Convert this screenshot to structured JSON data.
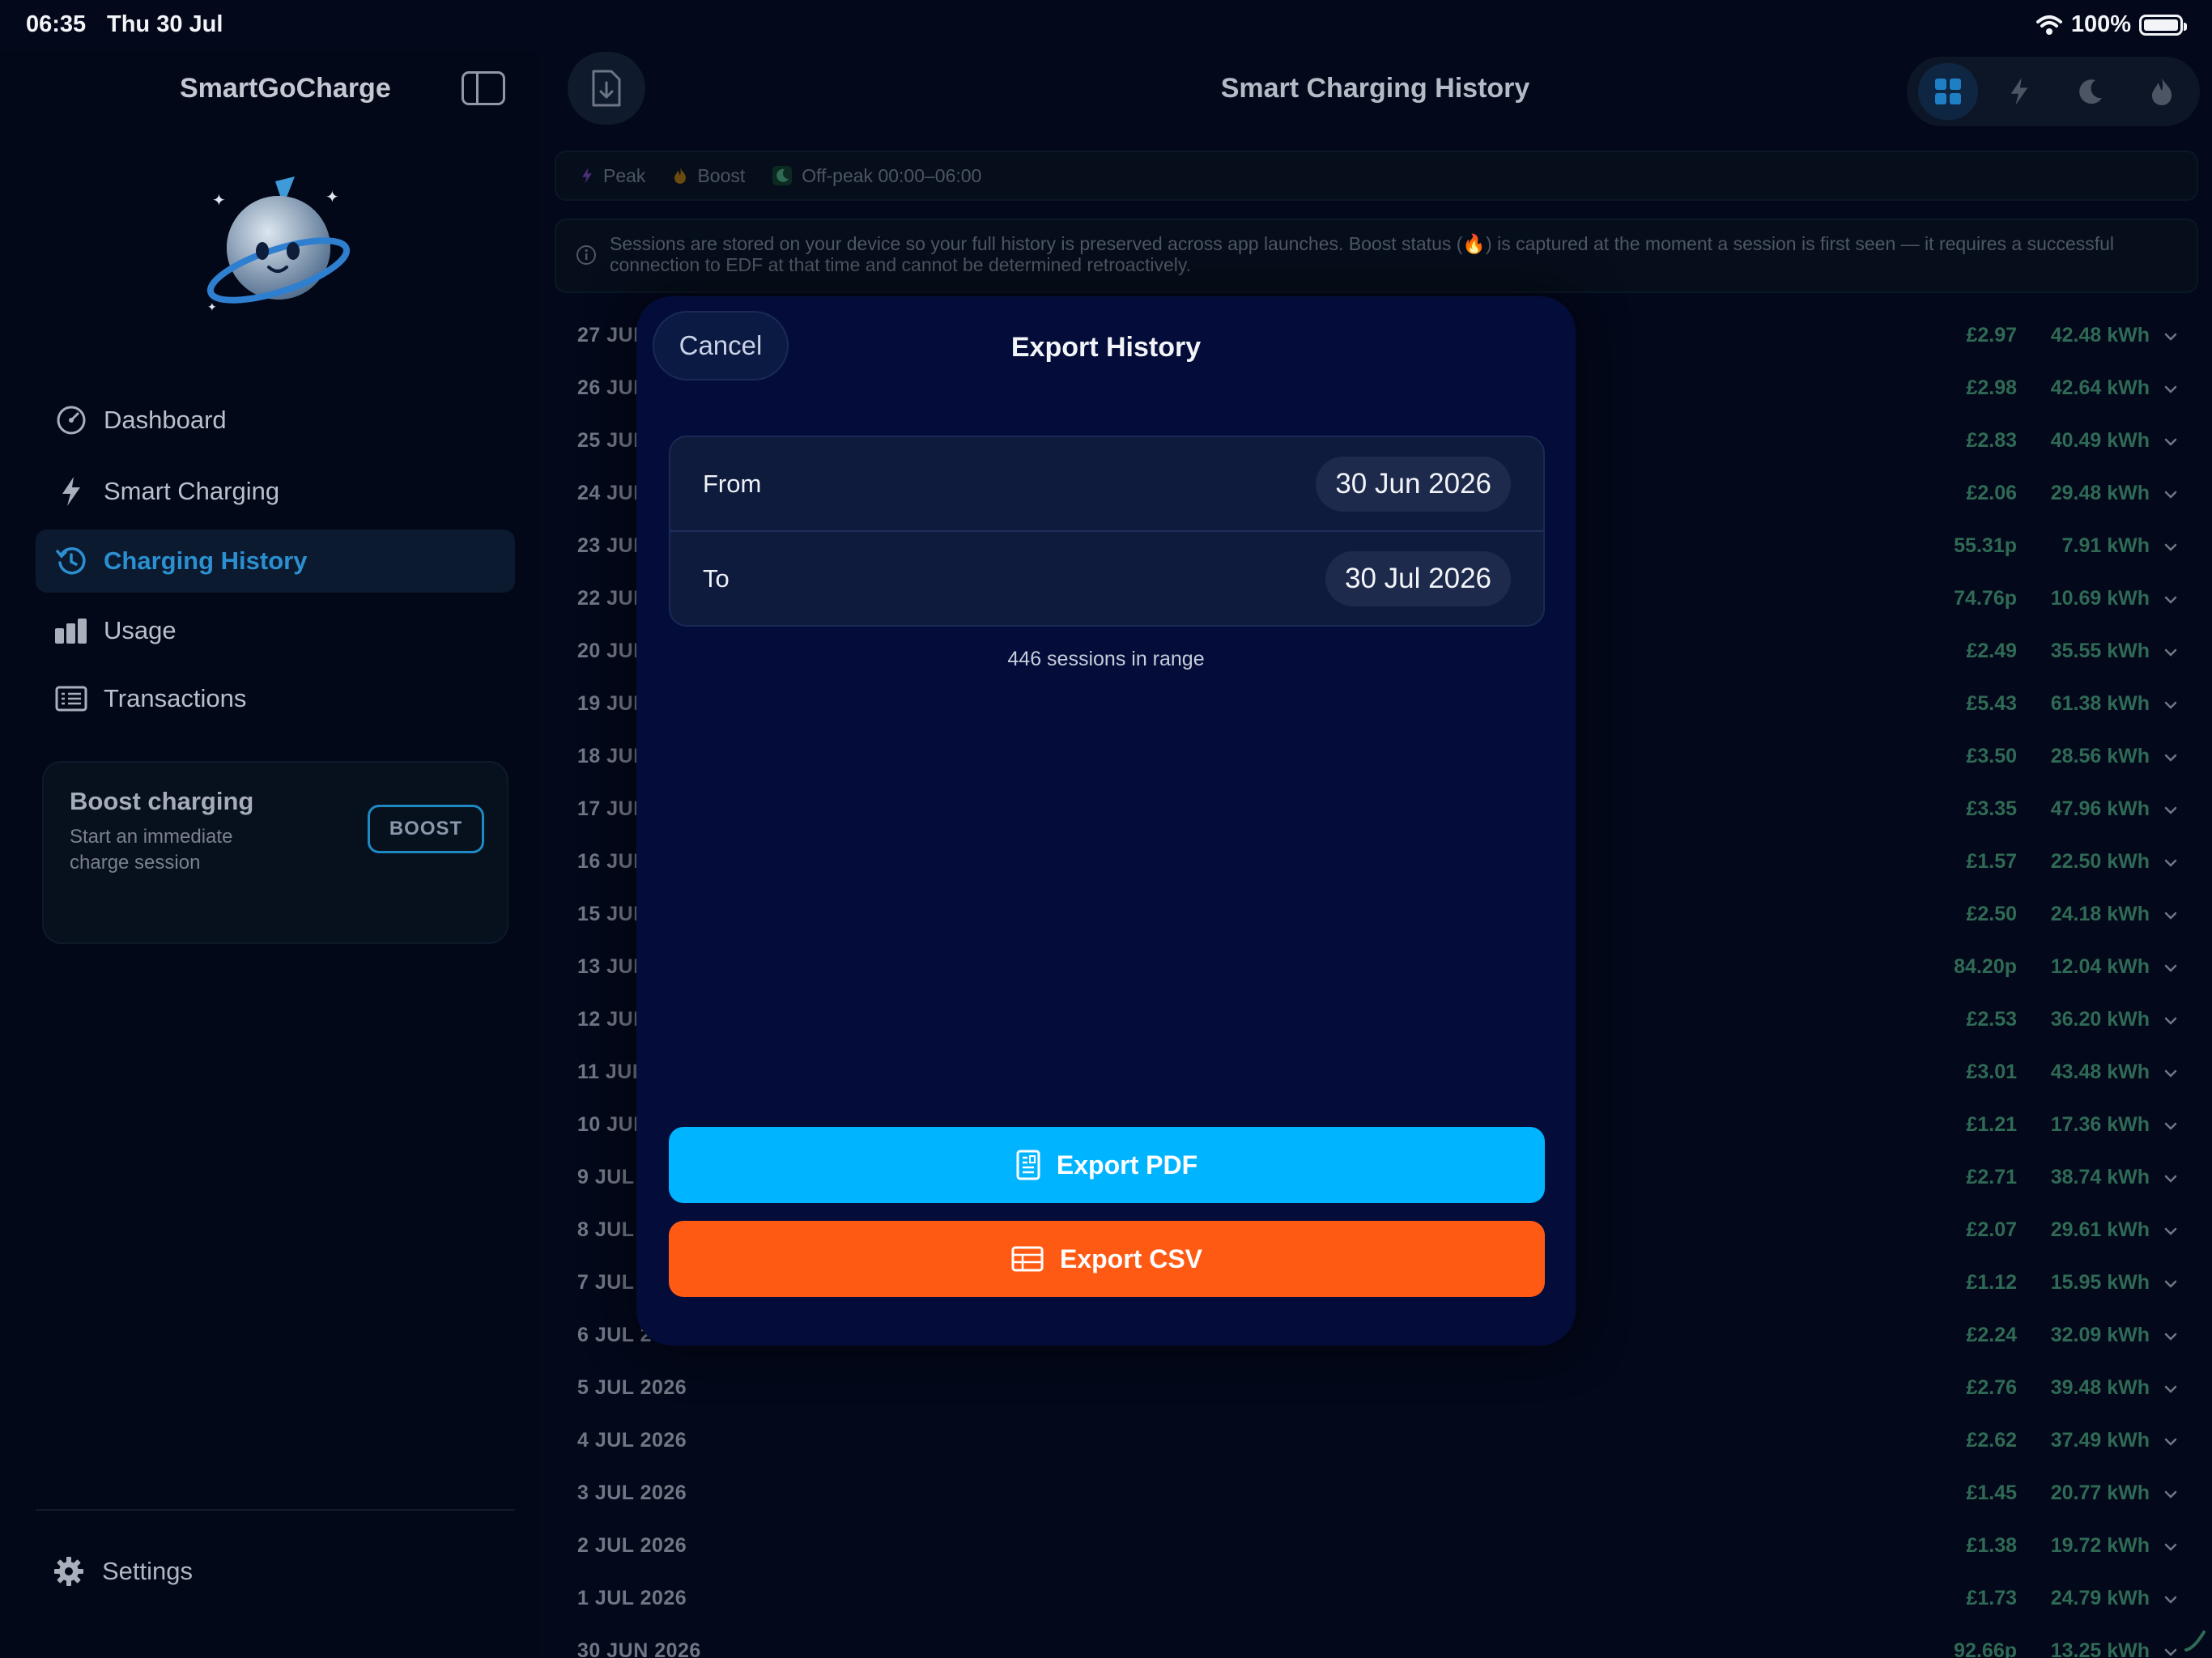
{
  "status_bar": {
    "time": "06:35",
    "date": "Thu 30 Jul",
    "battery": "100%"
  },
  "sidebar": {
    "app_title": "SmartGoCharge",
    "nav": [
      {
        "label": "Dashboard",
        "icon": "speedometer-icon",
        "active": false
      },
      {
        "label": "Smart Charging",
        "icon": "bolt-icon",
        "active": false
      },
      {
        "label": "Charging History",
        "icon": "history-icon",
        "active": true
      },
      {
        "label": "Usage",
        "icon": "bar-chart-icon",
        "active": false
      },
      {
        "label": "Transactions",
        "icon": "list-icon",
        "active": false
      }
    ],
    "boost": {
      "title": "Boost charging",
      "description": "Start an immediate charge session",
      "button": "BOOST"
    },
    "settings_label": "Settings"
  },
  "header": {
    "title": "Smart Charging History"
  },
  "legend": {
    "peak": "Peak",
    "boost": "Boost",
    "offpeak": "Off-peak 00:00–06:00"
  },
  "info_text": "Sessions are stored on your device so your full history is preserved across app launches. Boost status (🔥) is captured at the moment a session is first seen — it requires a successful connection to EDF at that time and cannot be determined retroactively.",
  "history": [
    {
      "date": "27 JUL",
      "cost": "£2.97",
      "kwh": "42.48 kWh"
    },
    {
      "date": "26 JUL",
      "cost": "£2.98",
      "kwh": "42.64 kWh"
    },
    {
      "date": "25 JUL",
      "cost": "£2.83",
      "kwh": "40.49 kWh"
    },
    {
      "date": "24 JUL",
      "cost": "£2.06",
      "kwh": "29.48 kWh"
    },
    {
      "date": "23 JUL",
      "cost": "55.31p",
      "kwh": "7.91 kWh"
    },
    {
      "date": "22 JUL",
      "cost": "74.76p",
      "kwh": "10.69 kWh"
    },
    {
      "date": "20 JUL",
      "cost": "£2.49",
      "kwh": "35.55 kWh"
    },
    {
      "date": "19 JUL",
      "cost": "£5.43",
      "kwh": "61.38 kWh"
    },
    {
      "date": "18 JUL",
      "cost": "£3.50",
      "kwh": "28.56 kWh"
    },
    {
      "date": "17 JUL",
      "cost": "£3.35",
      "kwh": "47.96 kWh"
    },
    {
      "date": "16 JUL",
      "cost": "£1.57",
      "kwh": "22.50 kWh"
    },
    {
      "date": "15 JUL",
      "cost": "£2.50",
      "kwh": "24.18 kWh"
    },
    {
      "date": "13 JUL",
      "cost": "84.20p",
      "kwh": "12.04 kWh"
    },
    {
      "date": "12 JUL",
      "cost": "£2.53",
      "kwh": "36.20 kWh"
    },
    {
      "date": "11 JUL",
      "cost": "£3.01",
      "kwh": "43.48 kWh"
    },
    {
      "date": "10 JUL",
      "cost": "£1.21",
      "kwh": "17.36 kWh"
    },
    {
      "date": "9 JUL",
      "cost": "£2.71",
      "kwh": "38.74 kWh"
    },
    {
      "date": "8 JUL",
      "cost": "£2.07",
      "kwh": "29.61 kWh"
    },
    {
      "date": "7 JUL",
      "cost": "£1.12",
      "kwh": "15.95 kWh"
    },
    {
      "date": "6 JUL 2",
      "cost": "£2.24",
      "kwh": "32.09 kWh"
    },
    {
      "date": "5 JUL 2026",
      "cost": "£2.76",
      "kwh": "39.48 kWh"
    },
    {
      "date": "4 JUL 2026",
      "cost": "£2.62",
      "kwh": "37.49 kWh"
    },
    {
      "date": "3 JUL 2026",
      "cost": "£1.45",
      "kwh": "20.77 kWh"
    },
    {
      "date": "2 JUL 2026",
      "cost": "£1.38",
      "kwh": "19.72 kWh"
    },
    {
      "date": "1 JUL 2026",
      "cost": "£1.73",
      "kwh": "24.79 kWh"
    },
    {
      "date": "30 JUN 2026",
      "cost": "92.66p",
      "kwh": "13.25 kWh"
    }
  ],
  "modal": {
    "cancel": "Cancel",
    "title": "Export History",
    "from_label": "From",
    "from_value": "30 Jun 2026",
    "to_label": "To",
    "to_value": "30 Jul 2026",
    "sessions_text": "446 sessions in range",
    "export_pdf": "Export PDF",
    "export_csv": "Export CSV"
  },
  "colors": {
    "accent_blue": "#00b4ff",
    "accent_orange": "#ff5a14",
    "active_nav": "#2b8fd0",
    "value_green": "#2f6a55"
  }
}
